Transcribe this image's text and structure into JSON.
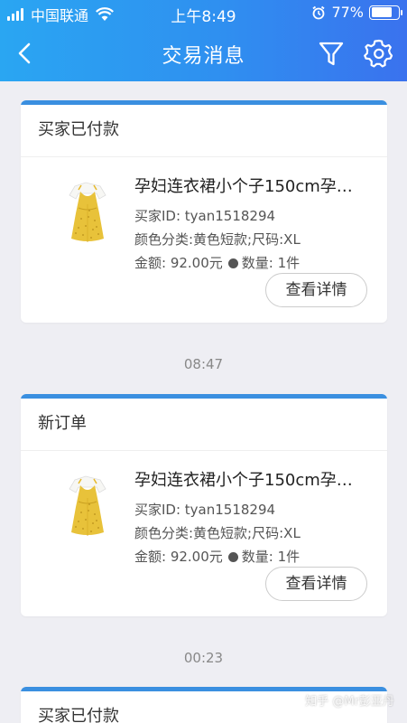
{
  "status_bar": {
    "carrier": "中国联通",
    "time": "上午8:49",
    "battery": "77%",
    "battery_level": 0.77
  },
  "nav": {
    "title": "交易消息",
    "back_icon": "chevron-left-icon",
    "filter_icon": "filter-icon",
    "settings_icon": "gear-icon"
  },
  "messages": [
    {
      "header": "买家已付款",
      "product_title": "孕妇连衣裙小个子150cm孕…",
      "buyer_id": "买家ID: tyan1518294",
      "variant": "颜色分类:黄色短款;尺码:XL",
      "amount": "金额: 92.00元",
      "quantity": "数量: 1件",
      "button": "查看详情"
    },
    {
      "header": "新订单",
      "product_title": "孕妇连衣裙小个子150cm孕…",
      "buyer_id": "买家ID: tyan1518294",
      "variant": "颜色分类:黄色短款;尺码:XL",
      "amount": "金额: 92.00元",
      "quantity": "数量: 1件",
      "button": "查看详情"
    },
    {
      "header": "买家已付款"
    }
  ],
  "timestamps": [
    "08:47",
    "00:23"
  ],
  "watermark": "知乎 @Mr彭亚丹",
  "colors": {
    "header_gradient_start": "#2aa6f2",
    "header_gradient_end": "#3a72ee",
    "card_accent": "#3a8fe0",
    "background": "#eeeef3"
  }
}
